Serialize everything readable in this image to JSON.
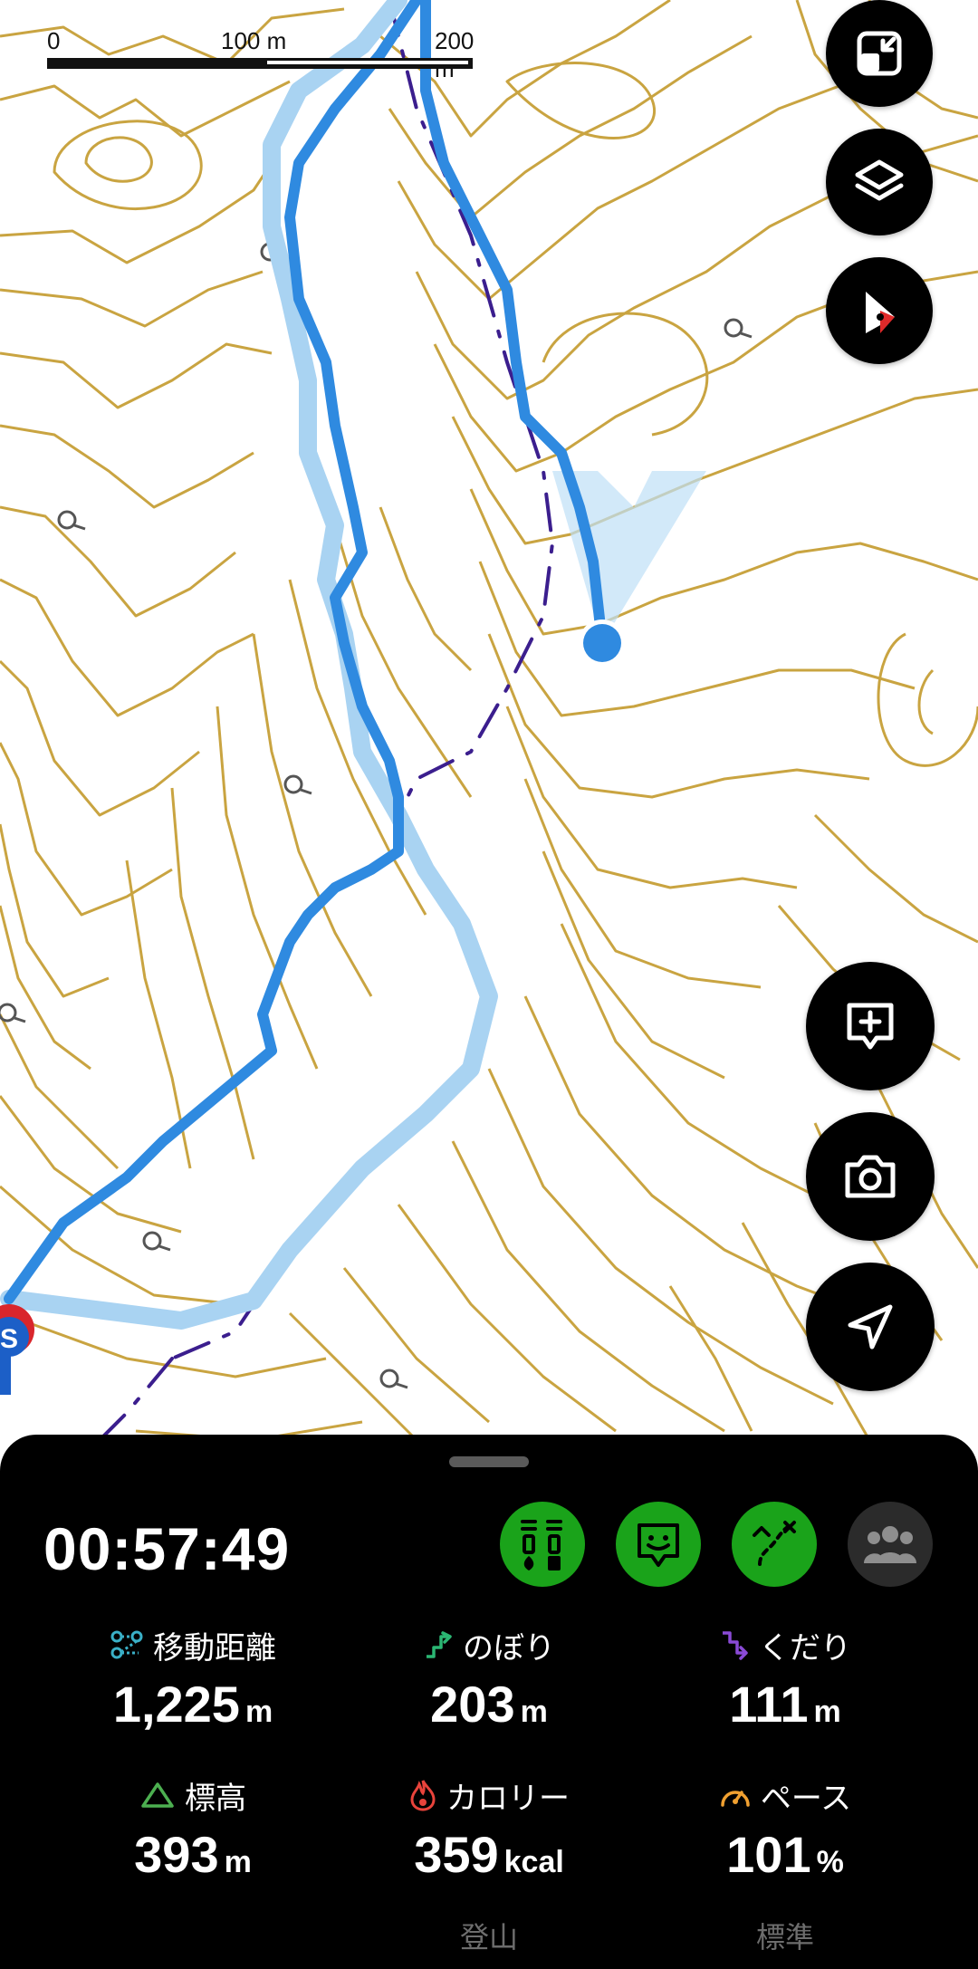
{
  "map": {
    "scale_bar": {
      "label_zero": "0",
      "label_mid": "100 m",
      "label_end": "200 m"
    },
    "colors": {
      "contour": "#c9a441",
      "track": "#2f8ae0",
      "planned_route": "#a9d3f2",
      "trail": "#3b1e8e",
      "start_marker": "#d9262c"
    },
    "start_marker_text": "S"
  },
  "map_controls": {
    "fullscreen_icon": "minimize-window-icon",
    "layers_icon": "layers-icon",
    "compass_icon": "compass-icon",
    "add_note_icon": "add-comment-icon",
    "camera_icon": "camera-icon",
    "locate_icon": "navigation-arrow-icon"
  },
  "activity": {
    "elapsed_time": "00:57:49",
    "stats": [
      {
        "id": "distance",
        "label": "移動距離",
        "value": "1,225",
        "unit": "m",
        "icon": "route-icon",
        "icon_color": "#3ab0c7"
      },
      {
        "id": "ascent",
        "label": "のぼり",
        "value": "203",
        "unit": "m",
        "icon": "ascent-icon",
        "icon_color": "#2bb673"
      },
      {
        "id": "descent",
        "label": "くだり",
        "value": "111",
        "unit": "m",
        "icon": "descent-icon",
        "icon_color": "#8a4ad6"
      },
      {
        "id": "elevation",
        "label": "標高",
        "value": "393",
        "unit": "m",
        "icon": "mountain-icon",
        "icon_color": "#4caf50"
      },
      {
        "id": "calories",
        "label": "カロリー",
        "value": "359",
        "unit": "kcal",
        "icon": "flame-icon",
        "icon_color": "#e8433b"
      },
      {
        "id": "pace",
        "label": "ペース",
        "value": "101",
        "unit": "%",
        "icon": "speedometer-icon",
        "icon_color": "#f0a030"
      }
    ],
    "calorie_mode": "登山",
    "pace_mode": "標準"
  },
  "mode_buttons": [
    {
      "id": "route-info",
      "icon": "route-markers-icon",
      "active": true
    },
    {
      "id": "guide",
      "icon": "guide-face-icon",
      "active": true
    },
    {
      "id": "course",
      "icon": "course-arrows-icon",
      "active": true
    },
    {
      "id": "group",
      "icon": "group-icon",
      "active": false
    }
  ]
}
